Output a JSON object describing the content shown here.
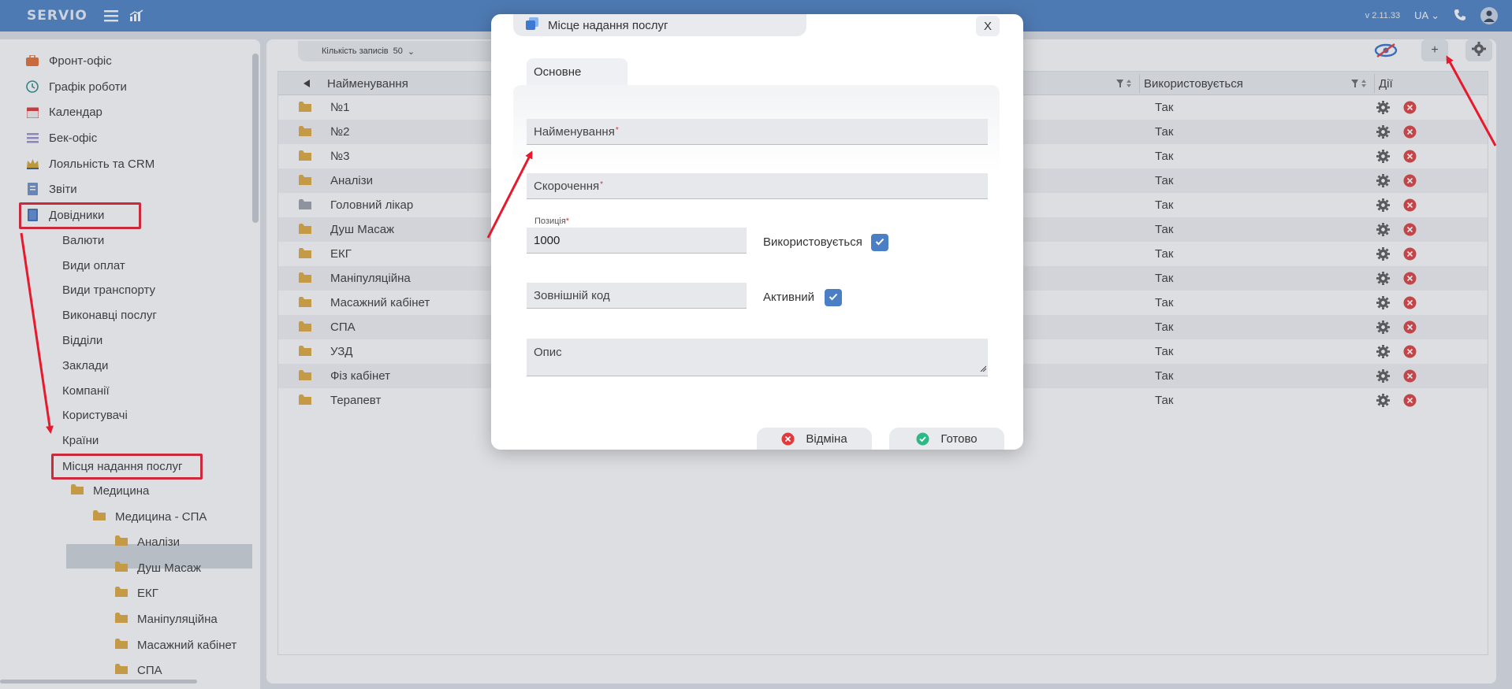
{
  "topbar": {
    "brand": "SERVIO",
    "version": "v 2.11.33",
    "lang": "UA"
  },
  "sidebar": {
    "items": [
      {
        "label": "Фронт-офіс",
        "icon": "briefcase-icon"
      },
      {
        "label": "Графік роботи",
        "icon": "clock-icon"
      },
      {
        "label": "Календар",
        "icon": "calendar-icon"
      },
      {
        "label": "Бек-офіс",
        "icon": "list-icon"
      },
      {
        "label": "Лояльність та CRM",
        "icon": "crown-icon"
      },
      {
        "label": "Звіти",
        "icon": "report-icon"
      },
      {
        "label": "Довідники",
        "icon": "book-icon"
      }
    ],
    "sub_items": [
      "Валюти",
      "Види оплат",
      "Види транспорту",
      "Виконавці послуг",
      "Відділи",
      "Заклади",
      "Компанії",
      "Користувачі",
      "Країни",
      "Місця надання послуг"
    ],
    "tree": [
      {
        "label": "Медицина"
      },
      {
        "label": "Медицина - СПА"
      },
      {
        "label": "Аналізи"
      },
      {
        "label": "Душ Масаж"
      },
      {
        "label": "ЕКГ"
      },
      {
        "label": "Маніпуляційна"
      },
      {
        "label": "Масажний кабінет"
      },
      {
        "label": "СПА"
      }
    ]
  },
  "toolbar": {
    "records_label": "Кількість записів",
    "records_value": "50",
    "add_label": "+"
  },
  "grid": {
    "columns": {
      "name": "Найменування",
      "used": "Використовується",
      "actions": "Дії"
    },
    "rows": [
      {
        "name": "№1",
        "used": "Так"
      },
      {
        "name": "№2",
        "used": "Так"
      },
      {
        "name": "№3",
        "used": "Так"
      },
      {
        "name": "Аналізи",
        "used": "Так"
      },
      {
        "name": "Головний лікар",
        "used": "Так"
      },
      {
        "name": "Душ Масаж",
        "used": "Так"
      },
      {
        "name": "ЕКГ",
        "used": "Так"
      },
      {
        "name": "Маніпуляційна",
        "used": "Так"
      },
      {
        "name": "Масажний кабінет",
        "used": "Так"
      },
      {
        "name": "СПА",
        "used": "Так"
      },
      {
        "name": "УЗД",
        "used": "Так"
      },
      {
        "name": "Фіз кабінет",
        "used": "Так"
      },
      {
        "name": "Терапевт",
        "used": "Так"
      }
    ]
  },
  "modal": {
    "title": "Місце надання послуг",
    "close": "X",
    "tab": "Основне",
    "fields": {
      "name": "Найменування",
      "short": "Скорочення",
      "position_label": "Позиція",
      "position_value": "1000",
      "used_label": "Використовується",
      "ext_code": "Зовнішній код",
      "active_label": "Активний",
      "description": "Опис",
      "required_mark": "*"
    },
    "cancel": "Відміна",
    "ok": "Готово"
  },
  "colors": {
    "topbar": "#4a7fc5",
    "highlight": "#e8192c",
    "folder": "#e0a83a",
    "delete": "#e03b3b",
    "ok": "#2eb886"
  }
}
